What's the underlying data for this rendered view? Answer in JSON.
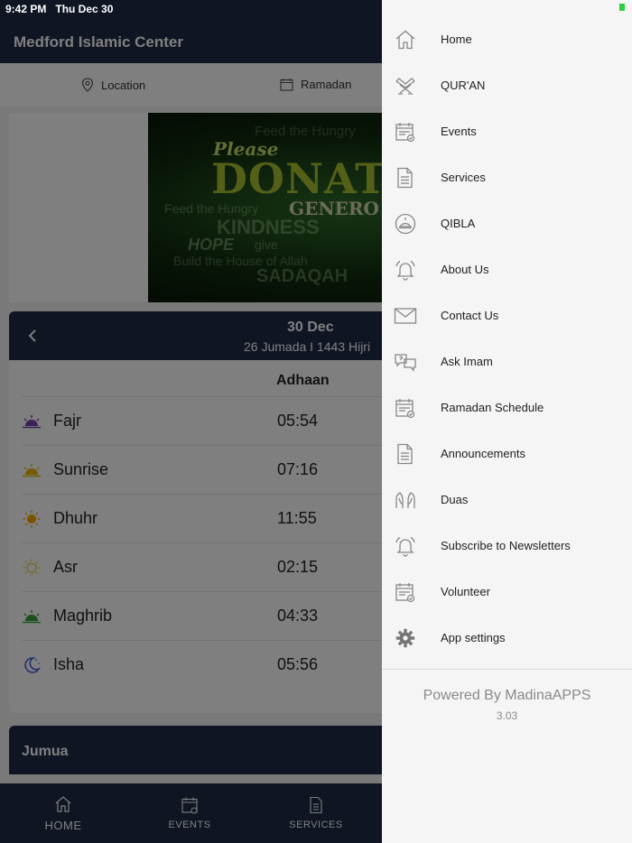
{
  "status_bar": {
    "time": "9:42 PM",
    "date": "Thu Dec 30"
  },
  "app": {
    "title": "Medford Islamic Center",
    "subnav": {
      "location": "Location",
      "ramadan": "Ramadan"
    },
    "banner": {
      "please": "Please",
      "donate": "DONAT",
      "generous": "GENERO",
      "feed1": "Feed the Hungry",
      "kindness": "KINDNESS",
      "hope": "HOPE",
      "give": "give",
      "build": "Build the House of Allah",
      "sadaqah": "SADAQAH",
      "feed2": "Feed the Hungry"
    },
    "prayer_card": {
      "date": "30 Dec",
      "hijri": "26 Jumada I 1443 Hijri",
      "column_header": "Adhaan",
      "rows": [
        {
          "name": "Fajr",
          "time": "05:54",
          "icon": "fajr-icon",
          "color": "#7b3fb5"
        },
        {
          "name": "Sunrise",
          "time": "07:16",
          "icon": "sunrise-icon",
          "color": "#e6b800"
        },
        {
          "name": "Dhuhr",
          "time": "11:55",
          "icon": "sun-icon",
          "color": "#f2a900"
        },
        {
          "name": "Asr",
          "time": "02:15",
          "icon": "sun-outline-icon",
          "color": "#f2c94c"
        },
        {
          "name": "Maghrib",
          "time": "04:33",
          "icon": "sunset-icon",
          "color": "#3aa13a"
        },
        {
          "name": "Isha",
          "time": "05:56",
          "icon": "moon-icon",
          "color": "#3a5bd9"
        }
      ]
    },
    "jumua_title": "Jumua",
    "tabs": {
      "home": "HOME",
      "events": "EVENTS",
      "services": "SERVICES"
    }
  },
  "drawer": {
    "items": [
      {
        "label": "Home",
        "icon": "home-icon"
      },
      {
        "label": "QUR'AN",
        "icon": "quran-icon"
      },
      {
        "label": "Events",
        "icon": "calendar-icon"
      },
      {
        "label": "Services",
        "icon": "document-icon"
      },
      {
        "label": "QIBLA",
        "icon": "qibla-icon"
      },
      {
        "label": "About Us",
        "icon": "bell-icon"
      },
      {
        "label": "Contact Us",
        "icon": "envelope-icon"
      },
      {
        "label": "Ask Imam",
        "icon": "chat-question-icon"
      },
      {
        "label": "Ramadan Schedule",
        "icon": "calendar-icon"
      },
      {
        "label": "Announcements",
        "icon": "document-icon"
      },
      {
        "label": "Duas",
        "icon": "praying-hands-icon"
      },
      {
        "label": "Subscribe to Newsletters",
        "icon": "bell-icon"
      },
      {
        "label": "Volunteer",
        "icon": "calendar-icon"
      },
      {
        "label": "App settings",
        "icon": "gear-icon"
      }
    ],
    "powered_by": "Powered By MadinaAPPS",
    "version": "3.03"
  },
  "colors": {
    "header": "#1e2a44",
    "drawer_bg": "#f5f5f5",
    "icon_gray": "#888888"
  }
}
